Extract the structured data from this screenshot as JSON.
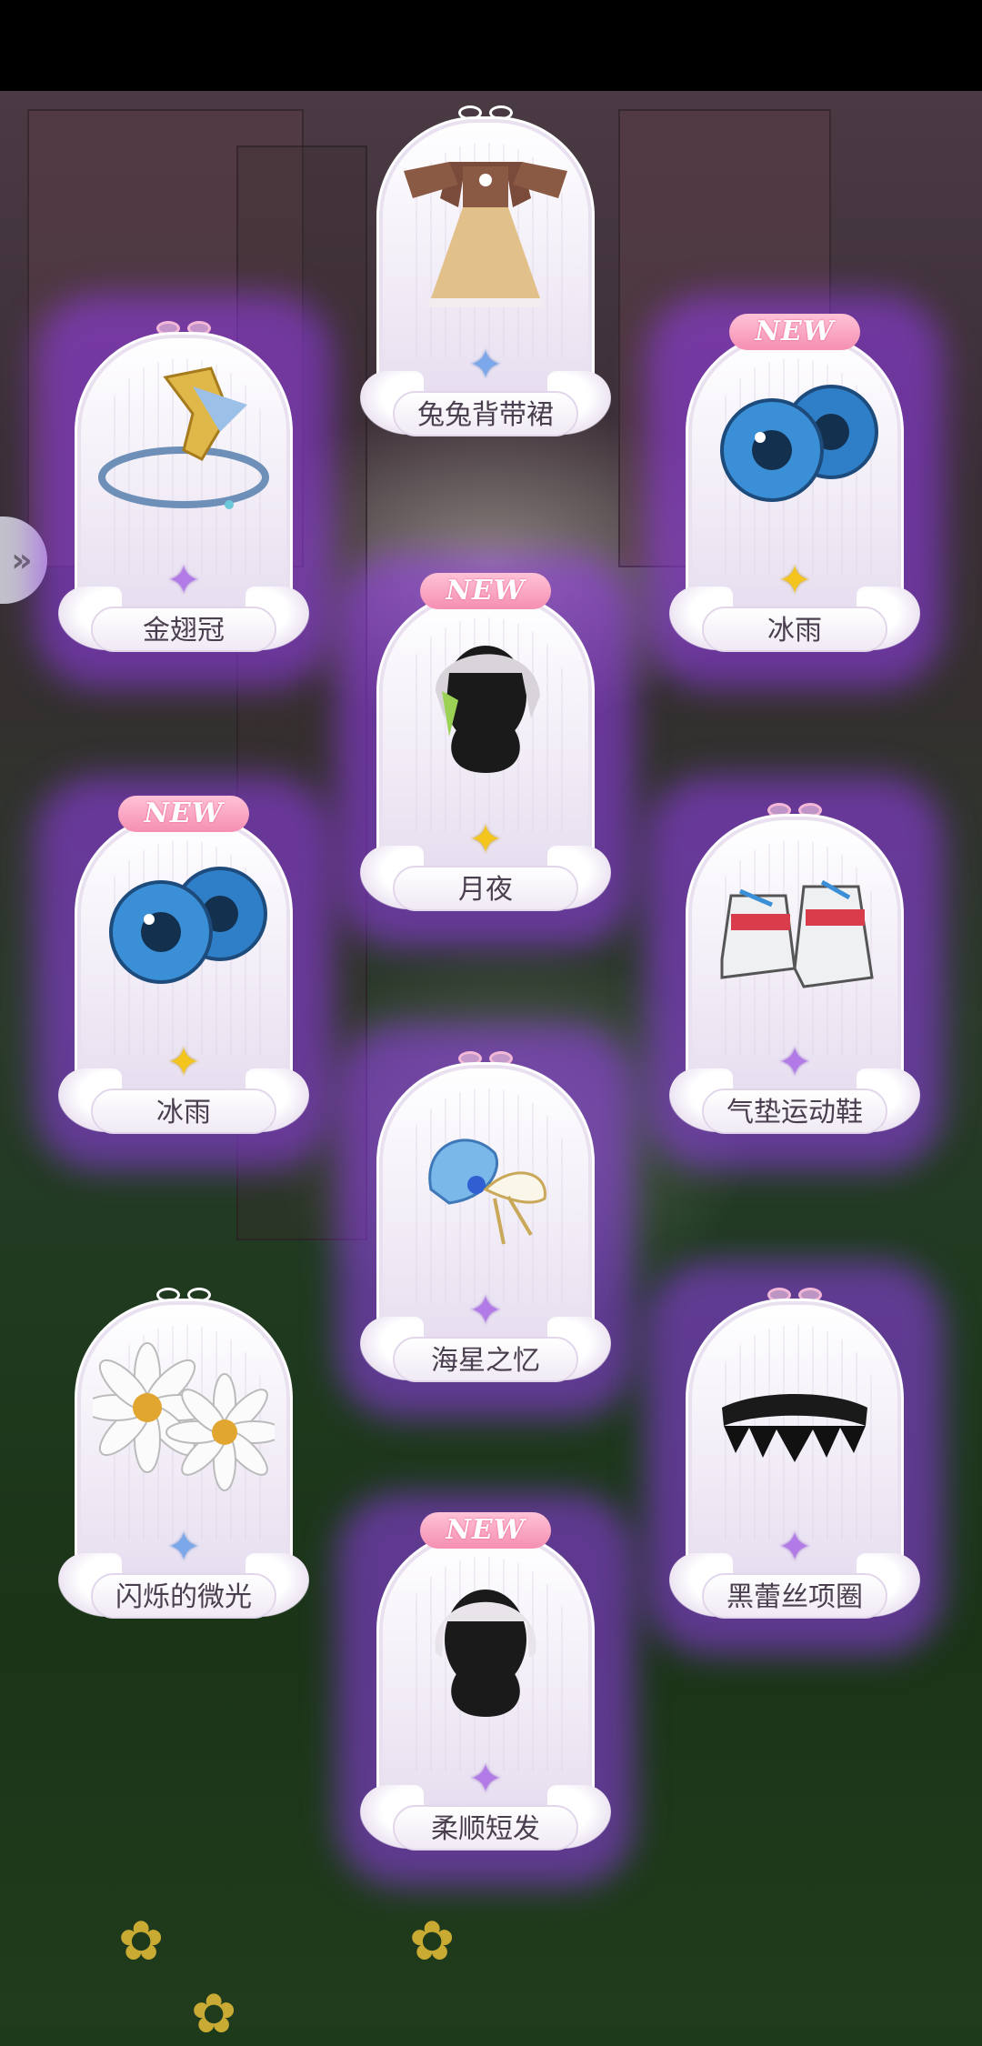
{
  "cards": [
    {
      "name": "兔兔背带裙",
      "badge": "",
      "rarity": "blue",
      "item_icon": "dress-icon"
    },
    {
      "name": "金翅冠",
      "badge": "",
      "rarity": "purple",
      "item_icon": "crown-icon"
    },
    {
      "name": "冰雨",
      "badge": "NEW",
      "rarity": "gold",
      "item_icon": "eyes-icon"
    },
    {
      "name": "月夜",
      "badge": "NEW",
      "rarity": "gold",
      "item_icon": "hair-icon"
    },
    {
      "name": "冰雨",
      "badge": "NEW",
      "rarity": "gold",
      "item_icon": "eyes-icon"
    },
    {
      "name": "气垫运动鞋",
      "badge": "",
      "rarity": "purple",
      "item_icon": "sneakers-icon"
    },
    {
      "name": "海星之忆",
      "badge": "",
      "rarity": "purple",
      "item_icon": "hair-ornament-icon"
    },
    {
      "name": "闪烁的微光",
      "badge": "",
      "rarity": "blue",
      "item_icon": "earrings-icon"
    },
    {
      "name": "黑蕾丝项圈",
      "badge": "",
      "rarity": "purple",
      "item_icon": "choker-icon"
    },
    {
      "name": "柔顺短发",
      "badge": "NEW",
      "rarity": "purple",
      "item_icon": "hair-icon"
    }
  ],
  "colors": {
    "glow": "#9b3cf0",
    "new_badge": "#f58fb2",
    "gold": "#f4c51c",
    "purple": "#b27ae6",
    "blue": "#7aa8ea"
  }
}
